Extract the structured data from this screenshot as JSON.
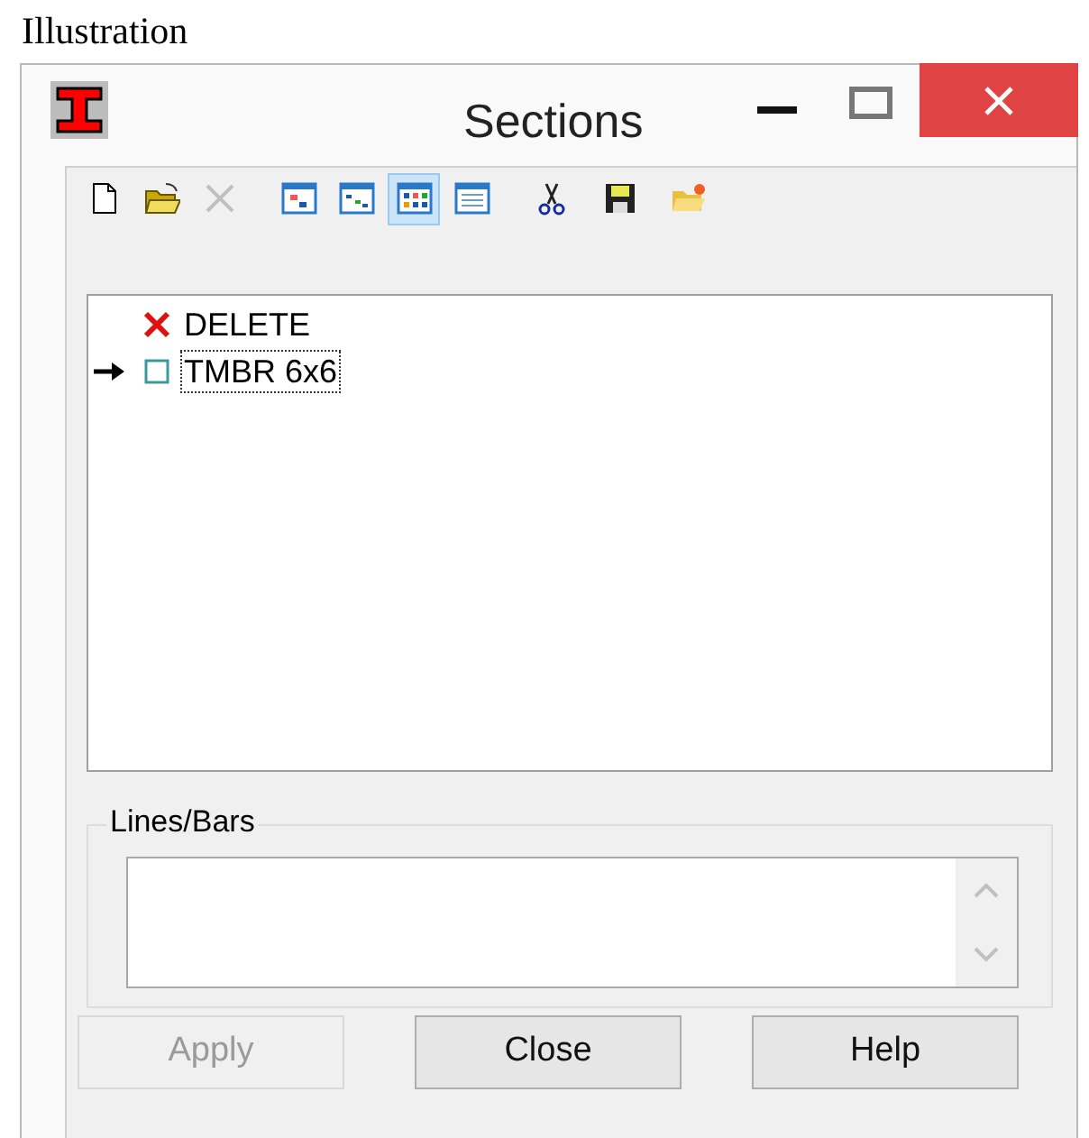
{
  "caption": "Illustration",
  "window": {
    "title": "Sections"
  },
  "toolbar": [
    {
      "kind": "new",
      "selected": false,
      "disabled": false
    },
    {
      "kind": "open",
      "selected": false,
      "disabled": false
    },
    {
      "kind": "delete",
      "selected": false,
      "disabled": true
    },
    {
      "kind": "view-a",
      "selected": false,
      "disabled": false
    },
    {
      "kind": "view-b",
      "selected": false,
      "disabled": false
    },
    {
      "kind": "view-c",
      "selected": true,
      "disabled": false
    },
    {
      "kind": "view-d",
      "selected": false,
      "disabled": false
    },
    {
      "kind": "cut",
      "selected": false,
      "disabled": false
    },
    {
      "kind": "save",
      "selected": false,
      "disabled": false
    },
    {
      "kind": "new-folder",
      "selected": false,
      "disabled": false
    }
  ],
  "sections": [
    {
      "label": "DELETE",
      "kind": "deleted",
      "current": false,
      "focused": false
    },
    {
      "label": "TMBR 6x6",
      "kind": "normal",
      "current": true,
      "focused": true
    }
  ],
  "group": {
    "label": "Lines/Bars"
  },
  "buttons": [
    {
      "label": "Apply",
      "disabled": true
    },
    {
      "label": "Close",
      "disabled": false
    },
    {
      "label": "Help",
      "disabled": false
    }
  ]
}
